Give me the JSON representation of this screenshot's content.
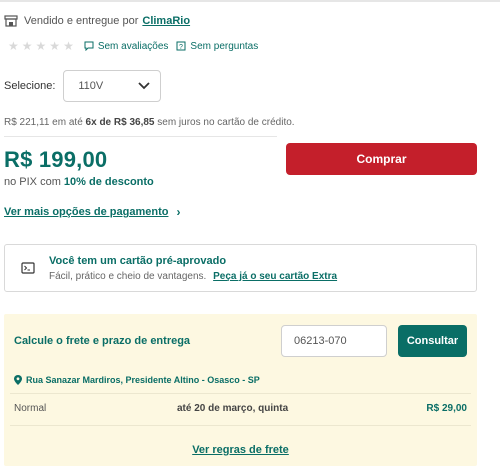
{
  "seller": {
    "prefix": "Vendido e entregue por",
    "name": "ClimaRio",
    "icon": "store-icon"
  },
  "rating": {
    "stars_filled": 0,
    "stars_total": 5,
    "reviews_link": "Sem avaliações",
    "questions_link": "Sem perguntas"
  },
  "variant": {
    "label": "Selecione:",
    "value": "110V"
  },
  "installments": {
    "prefix": "R$ 221,11 em até",
    "plan": "6x de R$ 36,85",
    "suffix": "sem juros no cartão de crédito."
  },
  "price": {
    "value": "R$ 199,00",
    "pix_prefix": "no PIX com",
    "pix_discount": "10% de desconto"
  },
  "buy_button": "Comprar",
  "more_payment": "Ver mais opções de pagamento",
  "card_offer": {
    "title": "Você tem um cartão pré-aprovado",
    "subtitle": "Fácil, prático e cheio de vantagens.",
    "link": "Peça já o seu cartão Extra"
  },
  "freight": {
    "title": "Calcule o frete e prazo de entrega",
    "cep_value": "06213-070",
    "consult_button": "Consultar",
    "address": "Rua Sanazar Mardiros, Presidente Altino - Osasco - SP",
    "options": [
      {
        "method": "Normal",
        "date": "até 20 de março, quinta",
        "price": "R$ 29,00"
      }
    ],
    "rules_link": "Ver regras de frete"
  },
  "colors": {
    "accent": "#0a6e66",
    "buy": "#c41f2b",
    "freight_bg": "#fdf8e1"
  }
}
